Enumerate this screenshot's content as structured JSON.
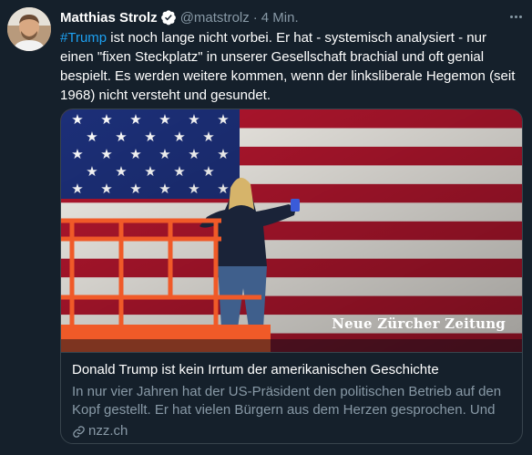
{
  "tweet": {
    "author_name": "Matthias Strolz",
    "handle": "@matstrolz",
    "separator": "·",
    "time": "4 Min.",
    "hashtag": "#Trump",
    "body": " ist noch lange nicht vorbei. Er hat - systemisch analysiert - nur einen \"fixen Steckplatz\" in unserer Gesellschaft brachial und oft genial bespielt. Es werden weitere kommen, wenn der linksliberale Hegemon (seit 1968) nicht versteht und gesundet."
  },
  "card": {
    "watermark": "Neue Zürcher Zeitung",
    "title": "Donald Trump ist kein Irrtum der amerikanischen Geschichte",
    "description": "In nur vier Jahren hat der US-Präsident den politischen Betrieb auf den Kopf gestellt. Er hat vielen Bürgern aus dem Herzen gesprochen. Und es…",
    "domain": "nzz.ch"
  },
  "colors": {
    "background": "#15202b",
    "text": "#ffffff",
    "muted": "#8899a6",
    "accent": "#1da1f2",
    "border": "#38444d"
  },
  "icons": {
    "verified": "verified-badge-icon",
    "more": "more-options-icon",
    "link": "link-icon"
  }
}
